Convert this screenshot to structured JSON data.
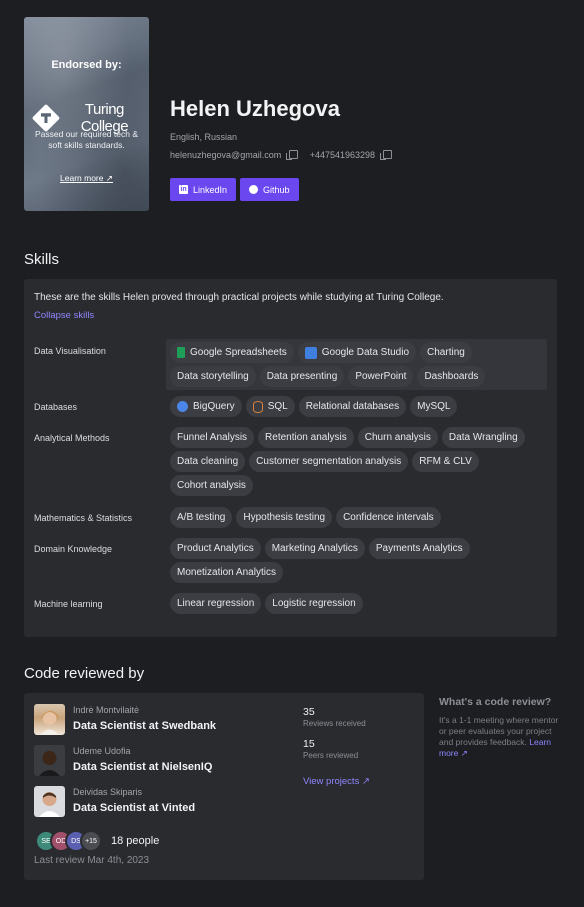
{
  "endorsement": {
    "title": "Endorsed by:",
    "brand": "Turing College",
    "description": "Passed our required tech & soft skills standards.",
    "link": "Learn more ↗"
  },
  "profile": {
    "name": "Helen Uzhegova",
    "languages": "English, Russian",
    "email": "helenuzhegova@gmail.com",
    "phone": "+447541963298",
    "linkedin_label": "LinkedIn",
    "github_label": "Github"
  },
  "skills": {
    "heading": "Skills",
    "intro": "These are the skills Helen proved through practical projects while studying at Turing College.",
    "collapse": "Collapse skills",
    "categories": [
      {
        "name": "Data Visualisation",
        "chips": [
          "Google Spreadsheets",
          "Google Data Studio",
          "Charting",
          "Data storytelling",
          "Data presenting",
          "PowerPoint",
          "Dashboards"
        ]
      },
      {
        "name": "Databases",
        "chips": [
          "BigQuery",
          "SQL",
          "Relational databases",
          "MySQL"
        ]
      },
      {
        "name": "Analytical Methods",
        "chips": [
          "Funnel Analysis",
          "Retention analysis",
          "Churn analysis",
          "Data Wrangling",
          "Data cleaning",
          "Customer segmentation analysis",
          "RFM & CLV",
          "Cohort analysis"
        ]
      },
      {
        "name": "Mathematics & Statistics",
        "chips": [
          "A/B testing",
          "Hypothesis testing",
          "Confidence intervals"
        ]
      },
      {
        "name": "Domain Knowledge",
        "chips": [
          "Product Analytics",
          "Marketing Analytics",
          "Payments Analytics",
          "Monetization Analytics"
        ]
      },
      {
        "name": "Machine learning",
        "chips": [
          "Linear regression",
          "Logistic regression"
        ]
      }
    ]
  },
  "review": {
    "heading": "Code reviewed by",
    "reviewers": [
      {
        "name": "Indrė Montvilaitė",
        "role": "Data Scientist at Swedbank"
      },
      {
        "name": "Udeme Udofia",
        "role": "Data Scientist at NielsenIQ"
      },
      {
        "name": "Deividas Skiparis",
        "role": "Data Scientist at Vinted"
      }
    ],
    "reviews_received_num": "35",
    "reviews_received_label": "Reviews received",
    "peers_reviewed_num": "15",
    "peers_reviewed_label": "Peers reviewed",
    "view_projects": "View projects ↗",
    "mini_avatars": [
      "SE",
      "OD",
      "DS",
      "+15"
    ],
    "people_count": "18 people",
    "last_review": "Last review Mar 4th, 2023"
  },
  "sidebar": {
    "title": "What's a code review?",
    "description": "It's a 1-1 meeting where mentor or peer evaluates your project and provides feedback.",
    "learn_more": "Learn more ↗"
  },
  "colors": {
    "accent": "#6b47f0",
    "link": "#8f86ff",
    "panel": "#2a2b2f",
    "background": "#1d1e21"
  }
}
